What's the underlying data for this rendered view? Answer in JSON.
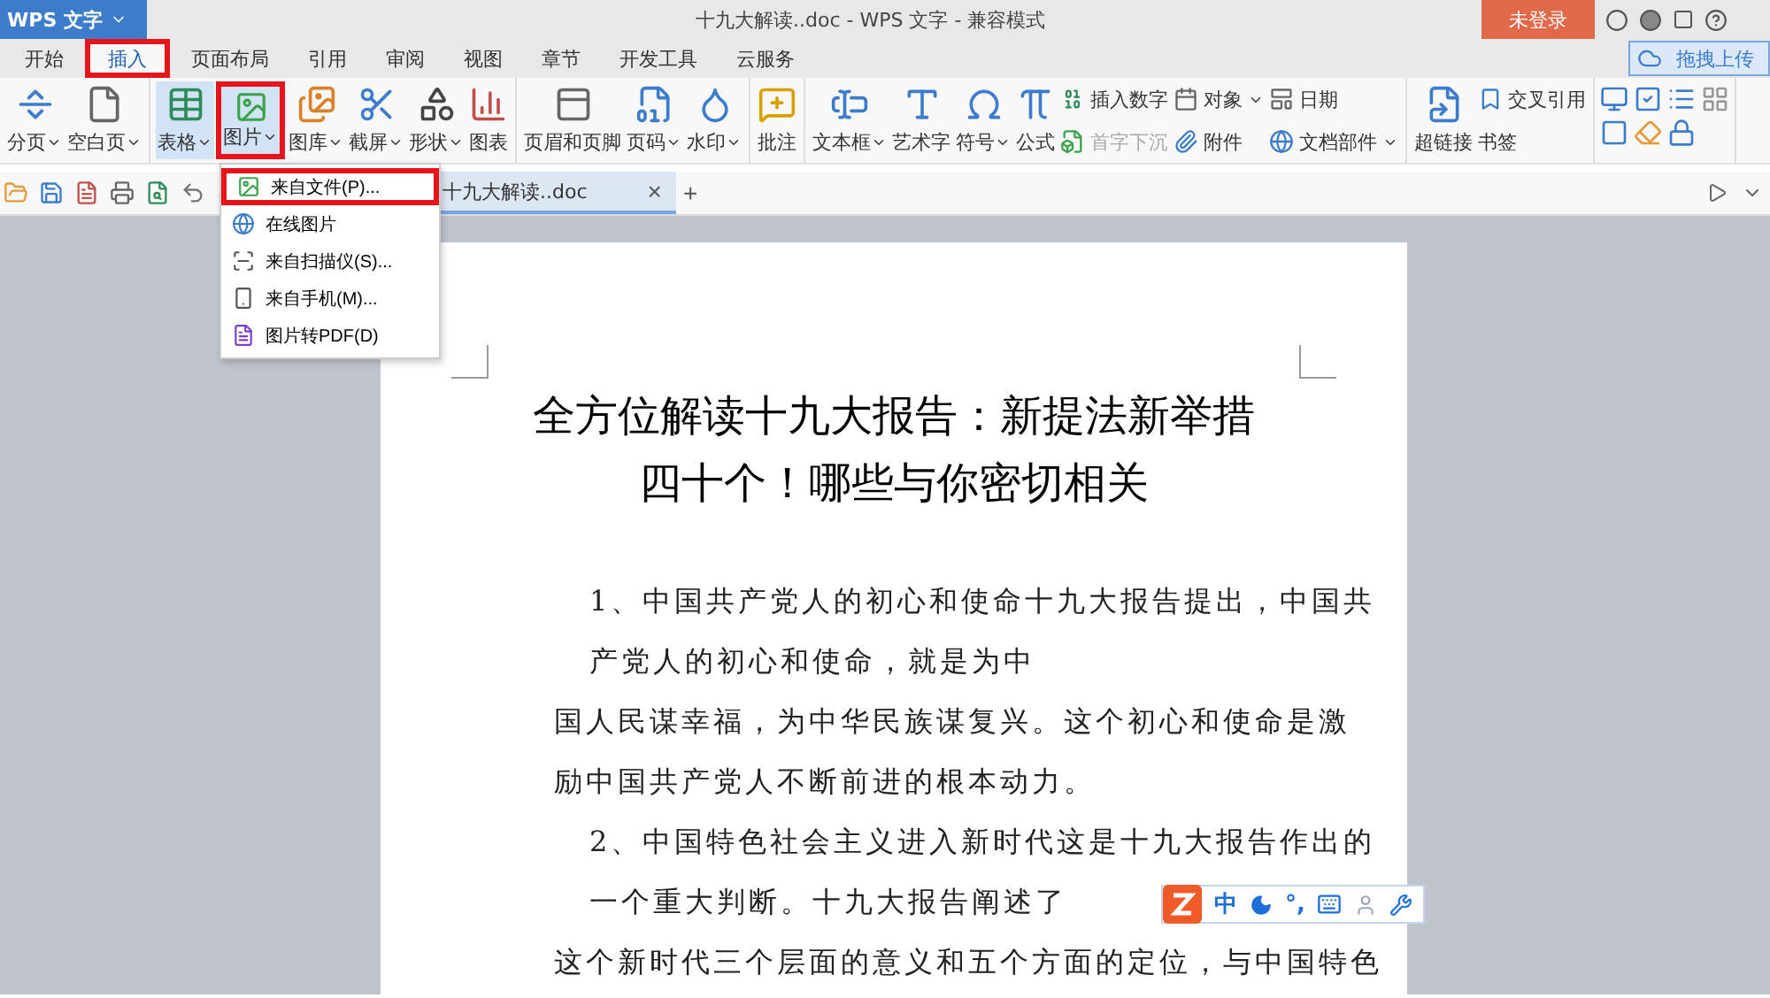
{
  "title_bar": {
    "app_button": "WPS 文字",
    "document_title": "十九大解读..doc - WPS 文字 - 兼容模式",
    "login_button": "未登录"
  },
  "menu_tabs": [
    {
      "label": "开始",
      "selected": false,
      "highlighted": false
    },
    {
      "label": "插入",
      "selected": true,
      "highlighted": true
    },
    {
      "label": "页面布局",
      "selected": false,
      "highlighted": false
    },
    {
      "label": "引用",
      "selected": false,
      "highlighted": false
    },
    {
      "label": "审阅",
      "selected": false,
      "highlighted": false
    },
    {
      "label": "视图",
      "selected": false,
      "highlighted": false
    },
    {
      "label": "章节",
      "selected": false,
      "highlighted": false
    },
    {
      "label": "开发工具",
      "selected": false,
      "highlighted": false
    },
    {
      "label": "云服务",
      "selected": false,
      "highlighted": false
    }
  ],
  "upload_button": "拖拽上传",
  "ribbon_groups": [
    {
      "items": [
        {
          "kind": "large",
          "label": "分页",
          "dropdown": true,
          "pressed": false,
          "highlighted": false
        },
        {
          "kind": "large",
          "label": "空白页",
          "dropdown": true,
          "pressed": false,
          "highlighted": false
        }
      ]
    },
    {
      "items": [
        {
          "kind": "large",
          "label": "表格",
          "dropdown": true,
          "pressed": true,
          "highlighted": false
        },
        {
          "kind": "large",
          "label": "图片",
          "dropdown": true,
          "pressed": true,
          "highlighted": true
        },
        {
          "kind": "large",
          "label": "图库",
          "dropdown": true,
          "pressed": false,
          "highlighted": false
        },
        {
          "kind": "large",
          "label": "截屏",
          "dropdown": true,
          "pressed": false,
          "highlighted": false
        },
        {
          "kind": "large",
          "label": "形状",
          "dropdown": true,
          "pressed": false,
          "highlighted": false
        },
        {
          "kind": "large",
          "label": "图表",
          "dropdown": false,
          "pressed": false,
          "highlighted": false
        }
      ]
    },
    {
      "items": [
        {
          "kind": "large",
          "label": "页眉和页脚",
          "dropdown": false,
          "pressed": false,
          "highlighted": false
        },
        {
          "kind": "large",
          "label": "页码",
          "dropdown": true,
          "pressed": false,
          "highlighted": false
        },
        {
          "kind": "large",
          "label": "水印",
          "dropdown": true,
          "pressed": false,
          "highlighted": false
        }
      ]
    },
    {
      "items": [
        {
          "kind": "large",
          "label": "批注",
          "dropdown": false,
          "pressed": false,
          "highlighted": false
        }
      ]
    },
    {
      "items": [
        {
          "kind": "large",
          "label": "文本框",
          "dropdown": true,
          "pressed": false,
          "highlighted": false
        },
        {
          "kind": "large",
          "label": "艺术字",
          "dropdown": false,
          "pressed": false,
          "highlighted": false
        },
        {
          "kind": "large",
          "label": "符号",
          "dropdown": true,
          "pressed": false,
          "highlighted": false
        },
        {
          "kind": "large",
          "label": "公式",
          "dropdown": false,
          "pressed": false,
          "highlighted": false
        },
        {
          "kind": "stack",
          "entries": [
            {
              "label": "插入数字",
              "dropdown": false,
              "disabled": false
            },
            {
              "label": "首字下沉",
              "dropdown": false,
              "disabled": true
            }
          ]
        },
        {
          "kind": "stack",
          "entries": [
            {
              "label": "对象",
              "dropdown": true,
              "disabled": false
            },
            {
              "label": "附件",
              "dropdown": false,
              "disabled": false
            }
          ]
        },
        {
          "kind": "stack",
          "entries": [
            {
              "label": "日期",
              "dropdown": false,
              "disabled": false
            },
            {
              "label": "文档部件",
              "dropdown": true,
              "disabled": false
            }
          ]
        }
      ]
    },
    {
      "items": [
        {
          "kind": "large",
          "label": "超链接",
          "dropdown": false,
          "pressed": false,
          "highlighted": false
        },
        {
          "kind": "stack",
          "entries": [
            {
              "label": "交叉引用",
              "dropdown": false,
              "disabled": false
            },
            {
              "label": "书签",
              "dropdown": false,
              "disabled": false
            }
          ]
        }
      ]
    },
    {
      "items": [
        {
          "kind": "icon_grid"
        }
      ]
    }
  ],
  "document_tab": {
    "label": "十九大解读..doc",
    "close": "×",
    "new_tab": "+"
  },
  "picture_menu": [
    {
      "label": "来自文件(P)...",
      "highlighted": true
    },
    {
      "label": "在线图片",
      "highlighted": false
    },
    {
      "label": "来自扫描仪(S)...",
      "highlighted": false
    },
    {
      "label": "来自手机(M)...",
      "highlighted": false
    },
    {
      "label": "图片转PDF(D)",
      "highlighted": false
    }
  ],
  "document": {
    "title_lines": [
      "全方位解读十九大报告：新提法新举措",
      "四十个！哪些与你密切相关"
    ],
    "blocks": [
      {
        "indented": true,
        "lines": [
          "1、中国共产党人的初心和使命十九大报告提出，中国共",
          "产党人的初心和使命，就是为中"
        ]
      },
      {
        "indented": false,
        "lines": [
          "国人民谋幸福，为中华民族谋复兴。这个初心和使命是激",
          "励中国共产党人不断前进的根本动力。"
        ]
      },
      {
        "indented": true,
        "lines": [
          "2、中国特色社会主义进入新时代这是十九大报告作出的",
          "一个重大判断。十九大报告阐述了"
        ]
      },
      {
        "indented": false,
        "lines": [
          "这个新时代三个层面的意义和五个方面的定位，与中国特色"
        ]
      }
    ]
  },
  "ime_toolbar": {
    "language": "中",
    "punctuation": "°,"
  }
}
